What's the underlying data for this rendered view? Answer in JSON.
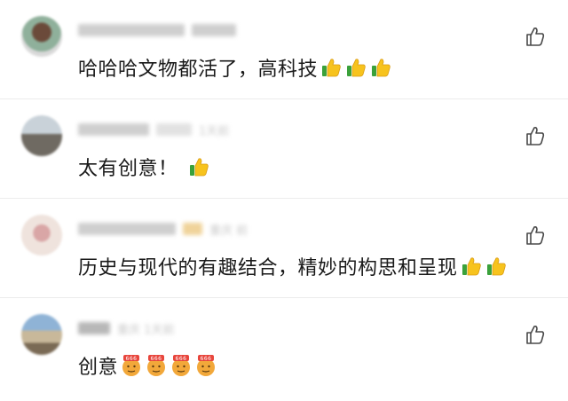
{
  "comments": [
    {
      "meta_time": "",
      "text": "哈哈哈文物都活了，高科技",
      "emojis": [
        "thumbs-up-icon",
        "thumbs-up-icon",
        "thumbs-up-icon"
      ]
    },
    {
      "meta_time": "1天前",
      "text": "太有创意！",
      "emojis": [
        "thumbs-up-icon"
      ]
    },
    {
      "meta_time": "重庆 前",
      "text": "历史与现代的有趣结合，精妙的构思和呈现",
      "emojis": [
        "thumbs-up-icon",
        "thumbs-up-icon"
      ]
    },
    {
      "meta_time": "重庆 1天前",
      "text": "创意",
      "emojis": [
        "666-face-icon",
        "666-face-icon",
        "666-face-icon",
        "666-face-icon"
      ]
    }
  ],
  "colors": {
    "thumb_yellow": "#f7c31d",
    "thumb_green": "#3aa13b",
    "like_outline": "#4a4a4a",
    "face_orange": "#f2a83a",
    "badge_red": "#e8453c"
  }
}
